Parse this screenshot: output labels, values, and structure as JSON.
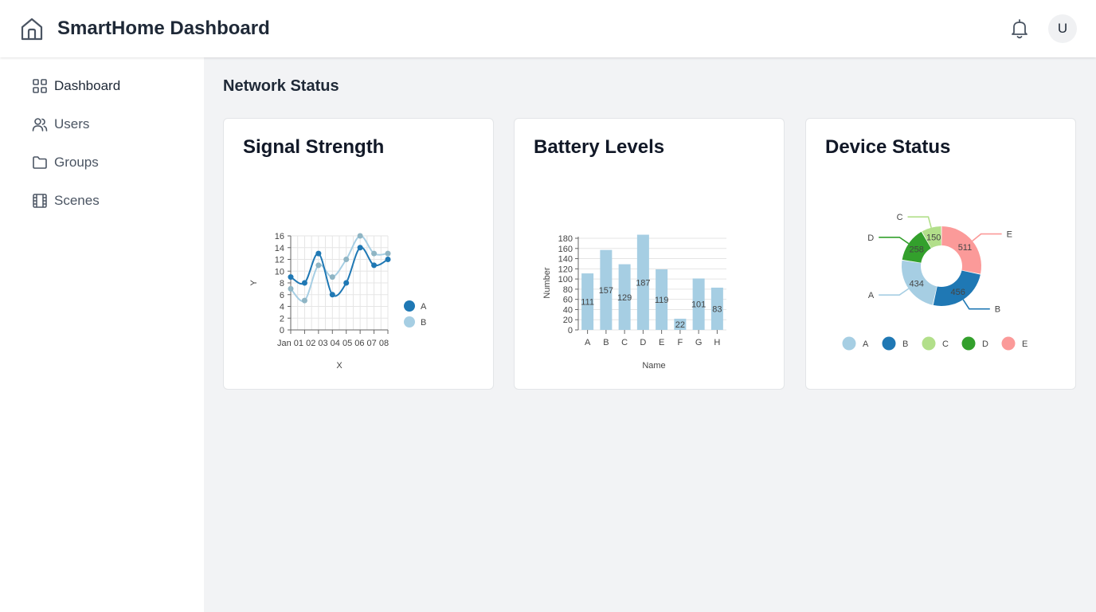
{
  "app": {
    "title": "SmartHome Dashboard",
    "avatar_initial": "U"
  },
  "icons": {
    "logo": "home-icon",
    "notifications": "bell-icon"
  },
  "sidebar": {
    "items": [
      {
        "label": "Dashboard",
        "icon": "grid-icon",
        "active": true
      },
      {
        "label": "Users",
        "icon": "users-icon"
      },
      {
        "label": "Groups",
        "icon": "folder-icon"
      },
      {
        "label": "Scenes",
        "icon": "film-icon"
      }
    ]
  },
  "main": {
    "section_title": "Network Status"
  },
  "cards": [
    {
      "title": "Signal Strength"
    },
    {
      "title": "Battery Levels"
    },
    {
      "title": "Device Status"
    }
  ],
  "colors": {
    "light_blue": "#a6cee3",
    "dark_blue": "#1f78b4",
    "light_green": "#b2df8a",
    "dark_green": "#33a02c",
    "pink": "#fb9a99"
  },
  "chart_data": [
    {
      "type": "line",
      "xlabel": "X",
      "ylabel": "Y",
      "ylim": [
        0,
        16
      ],
      "x": [
        "Jan 01",
        "02",
        "03",
        "04",
        "05",
        "06",
        "07",
        "08"
      ],
      "x_axis_text": "Jan 01 02 03 04 05 06 07 08",
      "yticks": [
        0,
        2,
        4,
        6,
        8,
        10,
        12,
        14,
        16
      ],
      "series": [
        {
          "name": "A",
          "color": "#1f78b4",
          "values": [
            9,
            8,
            13,
            6,
            8,
            14,
            11,
            12
          ]
        },
        {
          "name": "B",
          "color": "#a6cee3",
          "values": [
            7,
            5,
            11,
            9,
            12,
            16,
            13,
            13
          ]
        }
      ],
      "legend": "right",
      "grid": true
    },
    {
      "type": "bar",
      "xlabel": "Name",
      "ylabel": "Number",
      "ylim": [
        0,
        180
      ],
      "yticks": [
        0,
        20,
        40,
        60,
        80,
        100,
        120,
        140,
        160,
        180
      ],
      "categories": [
        "A",
        "B",
        "C",
        "D",
        "E",
        "F",
        "G",
        "H"
      ],
      "values": [
        111,
        157,
        129,
        187,
        119,
        22,
        101,
        83
      ],
      "color": "#a6cee3",
      "grid": true
    },
    {
      "type": "pie",
      "donut": true,
      "labels": [
        "A",
        "B",
        "C",
        "D",
        "E"
      ],
      "values": [
        434,
        456,
        150,
        258,
        511
      ],
      "colors": [
        "#a6cee3",
        "#1f78b4",
        "#b2df8a",
        "#33a02c",
        "#fb9a99"
      ],
      "legend": "bottom"
    }
  ]
}
